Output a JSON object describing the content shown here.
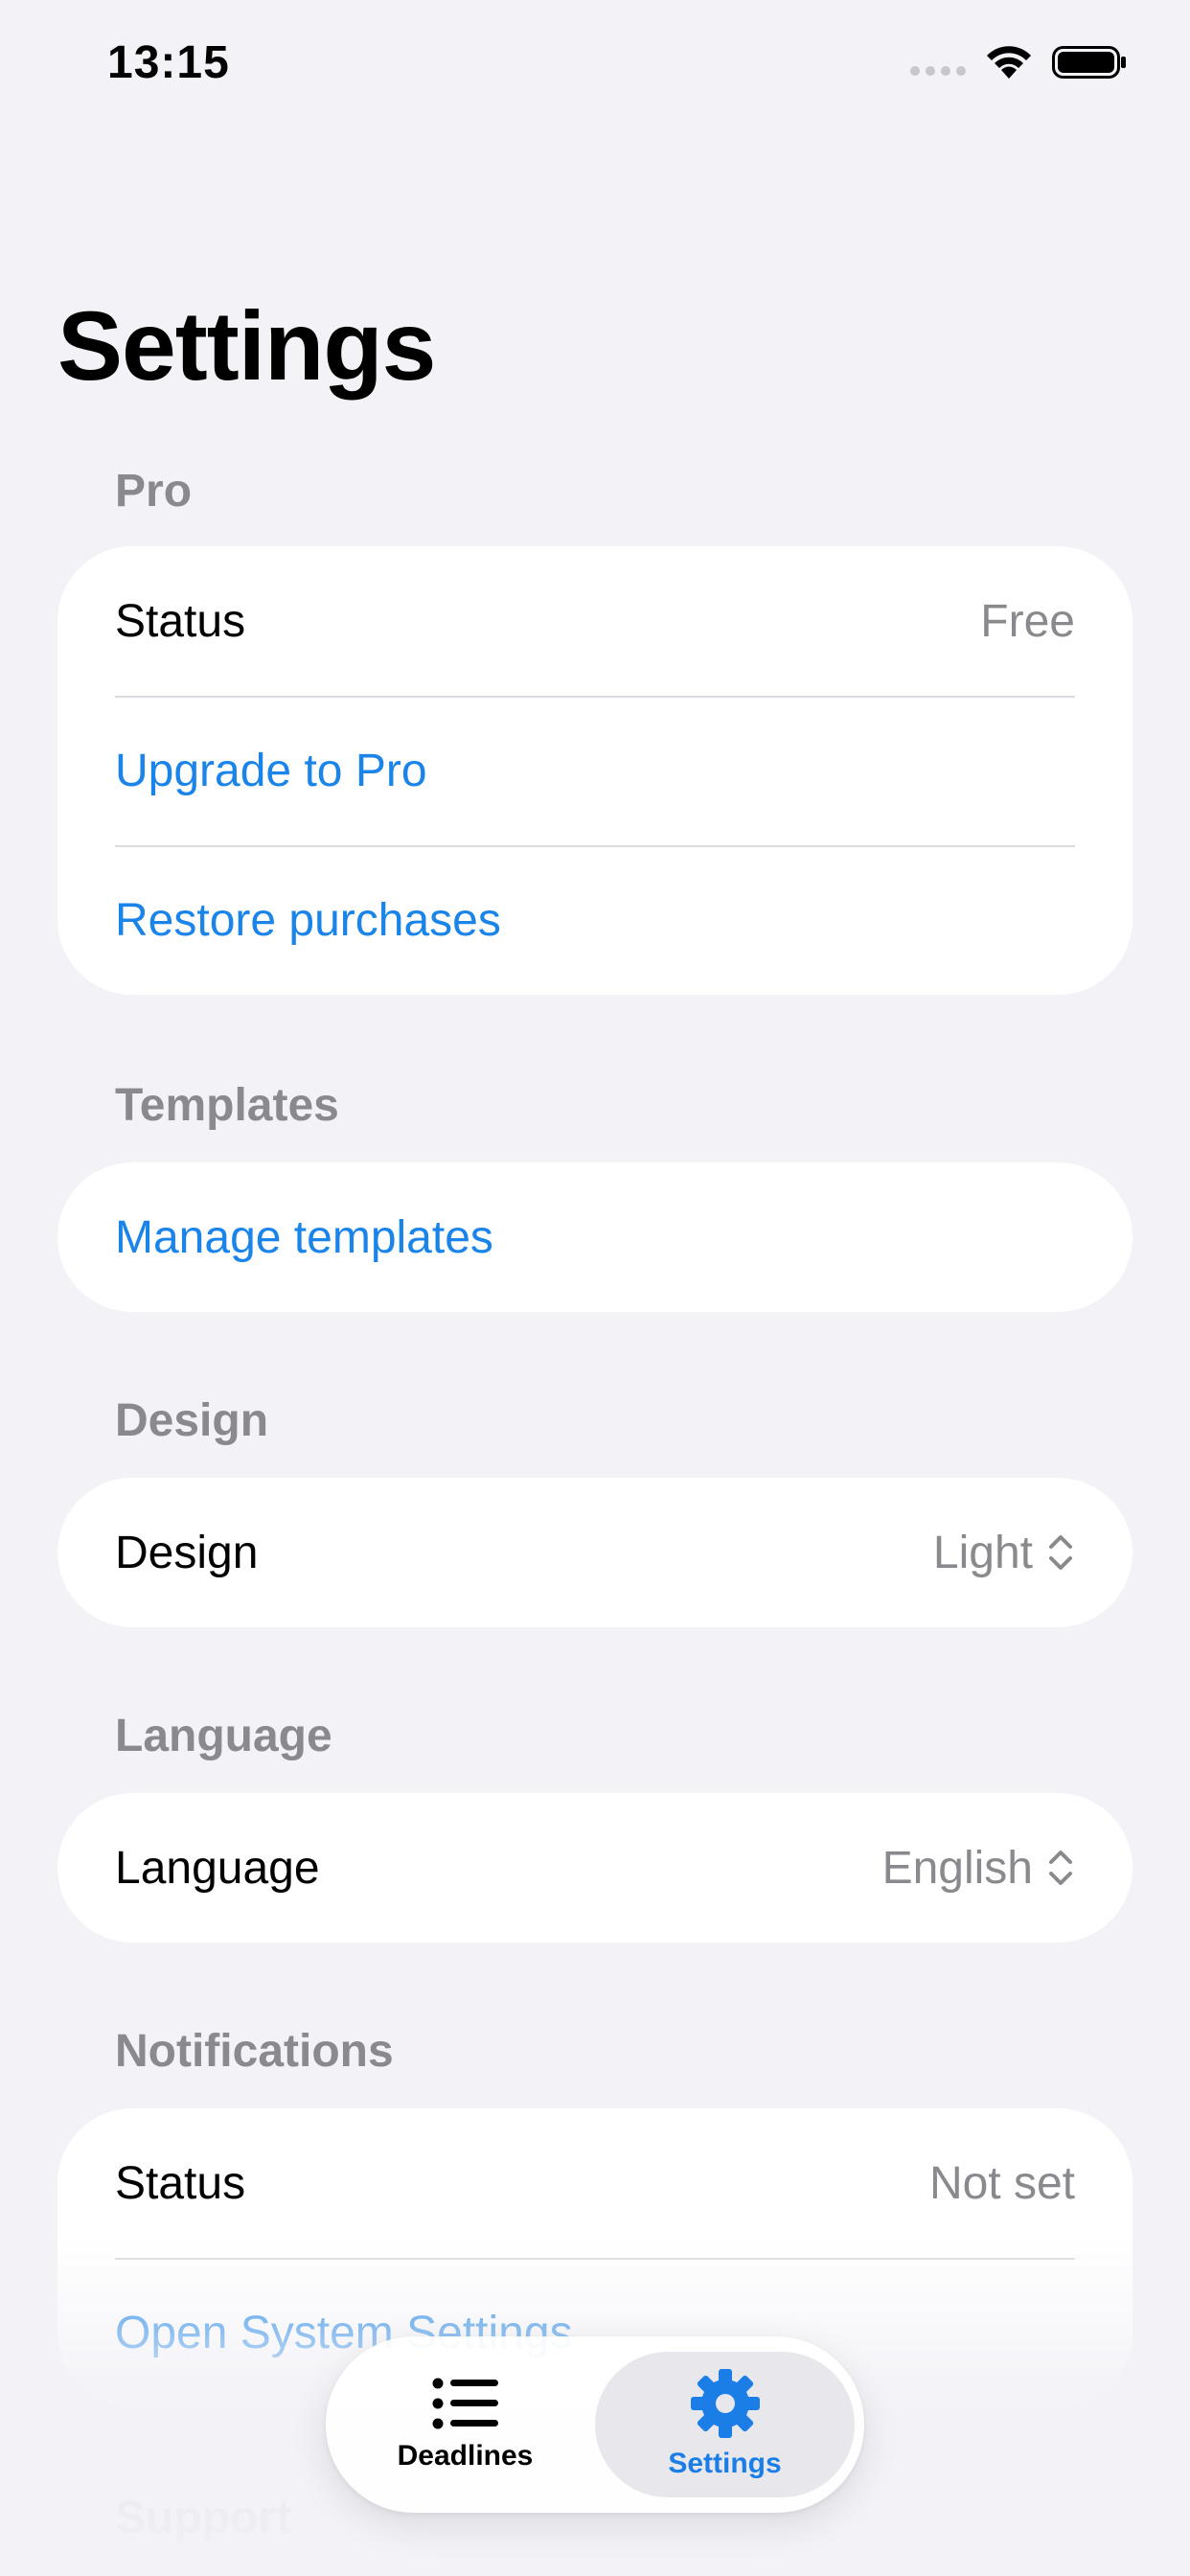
{
  "status_bar": {
    "time": "13:15"
  },
  "page_title": "Settings",
  "sections": {
    "pro": {
      "header": "Pro",
      "status_label": "Status",
      "status_value": "Free",
      "upgrade": "Upgrade to Pro",
      "restore": "Restore purchases"
    },
    "templates": {
      "header": "Templates",
      "manage": "Manage templates"
    },
    "design": {
      "header": "Design",
      "label": "Design",
      "value": "Light"
    },
    "language": {
      "header": "Language",
      "label": "Language",
      "value": "English"
    },
    "notifications": {
      "header": "Notifications",
      "status_label": "Status",
      "status_value": "Not set",
      "open_settings": "Open System Settings"
    },
    "support": {
      "header": "Support"
    }
  },
  "tabbar": {
    "tabs": [
      {
        "label": "Deadlines",
        "icon": "list-icon"
      },
      {
        "label": "Settings",
        "icon": "gear-icon",
        "active": true
      }
    ]
  },
  "colors": {
    "accent": "#1a84e8",
    "background": "#f2f2f7",
    "secondary_text": "#8a8a8e"
  }
}
